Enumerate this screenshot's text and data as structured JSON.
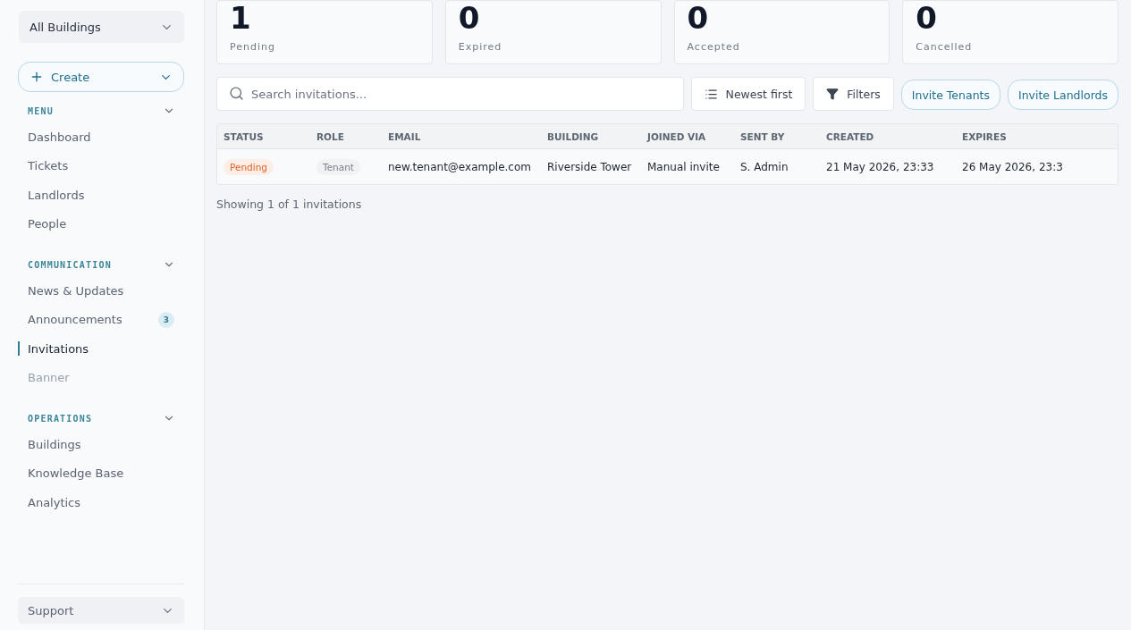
{
  "sidebar": {
    "scope": "All Buildings",
    "create": "Create",
    "sections": [
      {
        "title": "MENU",
        "expanded": true,
        "items": [
          {
            "label": "Dashboard",
            "selected": false,
            "disabled": false
          },
          {
            "label": "Tickets",
            "selected": false,
            "disabled": false
          },
          {
            "label": "Landlords",
            "selected": false,
            "disabled": false
          },
          {
            "label": "People",
            "selected": false,
            "disabled": false
          }
        ]
      },
      {
        "title": "COMMUNICATION",
        "expanded": true,
        "items": [
          {
            "label": "News & Updates",
            "selected": false,
            "disabled": false
          },
          {
            "label": "Announcements",
            "selected": false,
            "disabled": false,
            "badge": "3"
          },
          {
            "label": "Invitations",
            "selected": true,
            "disabled": false
          },
          {
            "label": "Banner",
            "selected": false,
            "disabled": true
          }
        ]
      },
      {
        "title": "OPERATIONS",
        "expanded": true,
        "items": [
          {
            "label": "Buildings",
            "selected": false,
            "disabled": false
          },
          {
            "label": "Knowledge Base",
            "selected": false,
            "disabled": false
          },
          {
            "label": "Analytics",
            "selected": false,
            "disabled": false
          }
        ]
      }
    ],
    "support": "Support"
  },
  "stats": [
    {
      "value": "1",
      "label": "Pending"
    },
    {
      "value": "0",
      "label": "Expired"
    },
    {
      "value": "0",
      "label": "Accepted"
    },
    {
      "value": "0",
      "label": "Cancelled"
    }
  ],
  "toolbar": {
    "search": {
      "placeholder": "Search invitations..."
    },
    "sort": "Newest first",
    "filters": "Filters",
    "actions": [
      "Invite Tenants",
      "Invite Landlords"
    ]
  },
  "table": {
    "columns": [
      "STATUS",
      "ROLE",
      "EMAIL",
      "BUILDING",
      "JOINED VIA",
      "SENT BY",
      "CREATED",
      "EXPIRES"
    ],
    "rows": [
      {
        "cells": [
          "Pending",
          "Tenant",
          "new.tenant@example.com",
          "Riverside Tower",
          "Manual invite",
          "S. Admin",
          "21 May 2026, 23:33",
          "26 May 2026, 23:3"
        ]
      }
    ]
  },
  "footer": "Showing 1 of 1 invitations"
}
